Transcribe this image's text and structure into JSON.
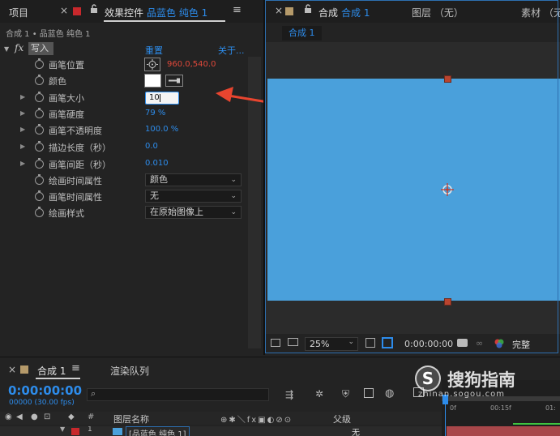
{
  "left_tabs": {
    "project": "项目",
    "effects_prefix": "效果控件",
    "effects_layer": "品蓝色 纯色 1",
    "menu_glyph": "≡"
  },
  "breadcrumb": "合成 1 • 品蓝色 纯色 1",
  "fx_header": {
    "fx": "fx",
    "effect_name": "写入",
    "reset": "重置",
    "about": "关于..."
  },
  "properties": [
    {
      "label": "画笔位置",
      "value": "960.0,540.0"
    },
    {
      "label": "颜色"
    },
    {
      "label": "画笔大小",
      "value": "10"
    },
    {
      "label": "画笔硬度",
      "value": "79 %"
    },
    {
      "label": "画笔不透明度",
      "value": "100.0 %"
    },
    {
      "label": "描边长度（秒）",
      "value": "0.0"
    },
    {
      "label": "画笔间距（秒）",
      "value": "0.010"
    },
    {
      "label": "绘画时间属性",
      "value": "颜色"
    },
    {
      "label": "画笔时间属性",
      "value": "无"
    },
    {
      "label": "绘画样式",
      "value": "在原始图像上"
    }
  ],
  "right_tabs": {
    "comp_prefix": "合成",
    "comp_name": "合成 1",
    "layer": "图层 （无）",
    "footage": "素材 （无",
    "inner_tab": "合成 1"
  },
  "viewer_bar": {
    "zoom": "25%",
    "time": "0:00:00:00",
    "quality": "完整"
  },
  "timeline": {
    "tab_comp": "合成 1",
    "tab_render": "渲染队列",
    "timecode": "0:00:00:00",
    "frames": "00000 (30.00 fps)",
    "search_placeholder": "",
    "col_source": "图层名称",
    "col_parent": "父级",
    "row_num": "1",
    "row_name": "[品蓝色 纯色 1]",
    "row_parent": "无",
    "ruler_labels": [
      "0f",
      "00:15f",
      "01:"
    ]
  },
  "watermark": {
    "brand": "搜狗指南",
    "url": "zhinan.sogou.com"
  },
  "colors": {
    "canvas": "#4aa0db",
    "accent_blue": "#2d8ceb",
    "red_value": "#e0483a",
    "arrow": "#e8452f"
  }
}
